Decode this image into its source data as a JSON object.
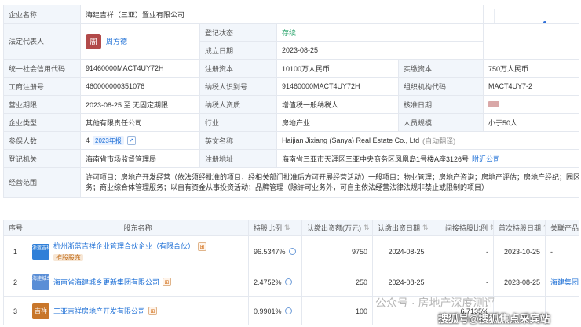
{
  "company_info": {
    "name_label": "企业名称",
    "name_value": "海建吉祥（三亚）置业有限公司",
    "legal_rep_label": "法定代表人",
    "legal_rep_avatar": "周",
    "legal_rep_value": "周方德",
    "status_label": "登记状态",
    "status_value": "存续",
    "est_date_label": "成立日期",
    "est_date_value": "2023-08-25",
    "credit_code_label": "统一社会信用代码",
    "credit_code_value": "91460000MACT4UY72H",
    "reg_capital_label": "注册资本",
    "reg_capital_value": "10100万人民币",
    "paid_capital_label": "实缴资本",
    "paid_capital_value": "750万人民币",
    "biz_reg_no_label": "工商注册号",
    "biz_reg_no_value": "460000000351076",
    "taxpayer_id_label": "纳税人识别号",
    "taxpayer_id_value": "91460000MACT4UY72H",
    "org_code_label": "组织机构代码",
    "org_code_value": "MACT4UY7-2",
    "biz_term_label": "营业期限",
    "biz_term_value": "2023-08-25 至 无固定期限",
    "taxpayer_qual_label": "纳税人资质",
    "taxpayer_qual_value": "增值税一般纳税人",
    "approval_date_label": "核准日期",
    "company_type_label": "企业类型",
    "company_type_value": "其他有限责任公司",
    "industry_label": "行业",
    "industry_value": "房地产业",
    "staff_size_label": "人员规模",
    "staff_size_value": "小于50人",
    "insured_label": "参保人数",
    "insured_value": "4",
    "insured_badge": "2023年报",
    "english_name_label": "英文名称",
    "english_name_value": "Haijian Jixiang (Sanya) Real Estate Co., Ltd",
    "auto_translate": "(自动翻译)",
    "reg_authority_label": "登记机关",
    "reg_authority_value": "海南省市场监督管理局",
    "reg_address_label": "注册地址",
    "reg_address_value": "海南省三亚市天涯区三亚中央商务区凤凰岛1号楼A座3126号",
    "nearby_companies": "附近公司",
    "scope_label": "经营范围",
    "scope_line1": "许可项目：房地产开发经营（依法须经批准的项目，经相关部门批准后方可开展经营活动）一般项目：物业管理；房地产咨询；房地产评估；房地产经纪；园区管理服",
    "scope_line2": "务；商业综合体管理服务；以自有资金从事投资活动；品牌管理（除许可业务外，可自主依法经营法律法规非禁止或限制的项目）"
  },
  "shareholders": {
    "headers": [
      "序号",
      "股东名称",
      "持股比例",
      "认缴出资额(万元)",
      "认缴出资日期",
      "间接持股比例",
      "首次持股日期",
      "关联产品/机构"
    ],
    "rows": [
      {
        "no": "1",
        "logo": "浙蓝吉祥",
        "name": "杭州浙蓝吉祥企业管理合伙企业（有限合伙）",
        "tag": "推股股东",
        "ratio": "96.5347%",
        "amount": "9750",
        "date": "2024-08-25",
        "indirect": "-",
        "first_date": "2023-10-25",
        "related": "-"
      },
      {
        "no": "2",
        "logo": "海建城乡",
        "name": "海南省海建城乡更新集团有限公司",
        "tag": "",
        "ratio": "2.4752%",
        "amount": "250",
        "date": "2024-08-25",
        "indirect": "-",
        "first_date": "2023-08-25",
        "related": "海建集团"
      },
      {
        "no": "3",
        "logo": "吉祥",
        "name": "三亚吉祥房地产开发有限公司",
        "tag": "",
        "ratio": "0.9901%",
        "amount": "100",
        "date": "",
        "indirect": "6.7135%",
        "first_date": "",
        "related": ""
      }
    ]
  },
  "watermark": {
    "text1": "公众号 · 房地产深度测评",
    "text2": "搜狐号@搜狐焦点采宾站"
  },
  "colors": {
    "label_bg": "#f2f6fb",
    "link": "#1d6fd6",
    "avatar": "#b24a4a",
    "chart": "#2f6fd8"
  }
}
